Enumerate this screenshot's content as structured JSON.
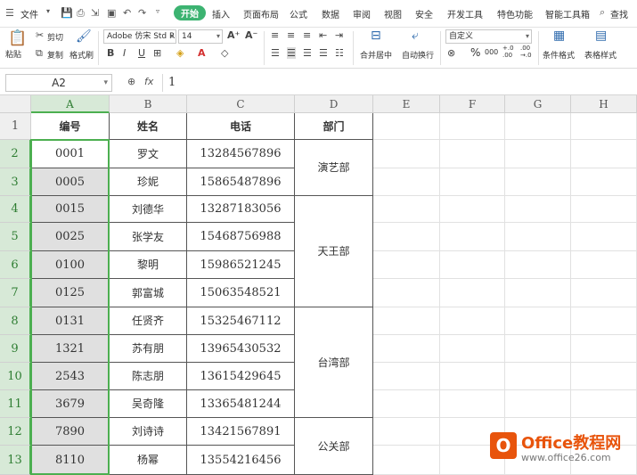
{
  "ribbon": {
    "file_label": "文件",
    "tabs": [
      "开始",
      "插入",
      "页面布局",
      "公式",
      "数据",
      "审阅",
      "视图",
      "安全",
      "开发工具",
      "特色功能",
      "智能工具箱"
    ],
    "search_label": "查找",
    "paste_label": "粘贴",
    "cut_label": "剪切",
    "copy_label": "复制",
    "format_painter_label": "格式刷",
    "font_name": "Adobe 仿宋 Std R",
    "font_size": "14",
    "merge_label": "合并居中",
    "wrap_label": "自动换行",
    "number_format": "自定义",
    "conditional_format_label": "条件格式",
    "table_style_label": "表格样式",
    "percent_label": "%",
    "thousands_label": "000",
    "inc_decimal_label": "+.0\n.00",
    "dec_decimal_label": ".00\n→.0"
  },
  "formula_bar": {
    "cell_ref": "A2",
    "fx_label": "fx",
    "content": "1"
  },
  "sheet": {
    "columns": [
      "A",
      "B",
      "C",
      "D",
      "E",
      "F",
      "G",
      "H"
    ],
    "rows": [
      "1",
      "2",
      "3",
      "4",
      "5",
      "6",
      "7",
      "8",
      "9",
      "10",
      "11",
      "12",
      "13"
    ],
    "header": {
      "id": "编号",
      "name": "姓名",
      "phone": "电话",
      "dept": "部门"
    },
    "records": [
      {
        "id": "0001",
        "name": "罗文",
        "phone": "13284567896"
      },
      {
        "id": "0005",
        "name": "珍妮",
        "phone": "15865487896"
      },
      {
        "id": "0015",
        "name": "刘德华",
        "phone": "13287183056"
      },
      {
        "id": "0025",
        "name": "张学友",
        "phone": "15468756988"
      },
      {
        "id": "0100",
        "name": "黎明",
        "phone": "15986521245"
      },
      {
        "id": "0125",
        "name": "郭富城",
        "phone": "15063548521"
      },
      {
        "id": "0131",
        "name": "任贤齐",
        "phone": "15325467112"
      },
      {
        "id": "1321",
        "name": "苏有朋",
        "phone": "13965430532"
      },
      {
        "id": "2543",
        "name": "陈志朋",
        "phone": "13615429645"
      },
      {
        "id": "3679",
        "name": "吴奇隆",
        "phone": "13365481244"
      },
      {
        "id": "7890",
        "name": "刘诗诗",
        "phone": "13421567891"
      },
      {
        "id": "8110",
        "name": "杨幂",
        "phone": "13554216456"
      }
    ],
    "departments": [
      "演艺部",
      "天王部",
      "台湾部",
      "公关部"
    ]
  },
  "watermark": {
    "title": "Office教程网",
    "url": "www.office26.com"
  }
}
